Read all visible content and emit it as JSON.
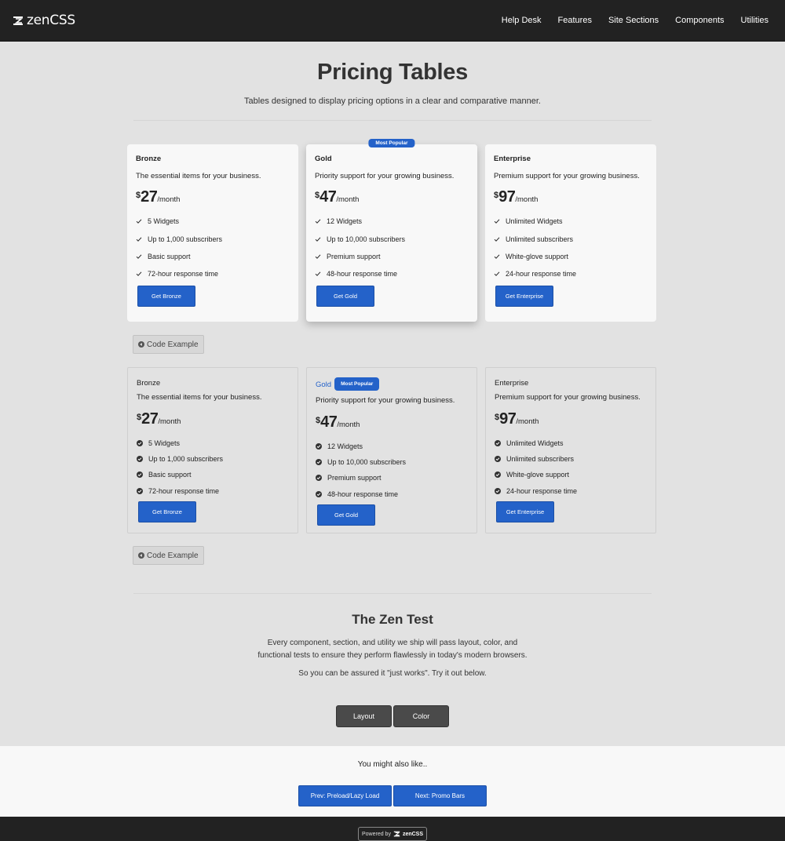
{
  "header": {
    "brand": "zenCSS",
    "nav": [
      "Help Desk",
      "Features",
      "Site Sections",
      "Components",
      "Utilities"
    ]
  },
  "hero": {
    "title": "Pricing Tables",
    "subtitle": "Tables designed to display pricing options in a clear and comparative manner."
  },
  "plans": [
    {
      "name": "Bronze",
      "desc": "The essential items for your business.",
      "currency": "$",
      "price": "27",
      "period": "/month",
      "features": [
        "5 Widgets",
        "Up to 1,000 subscribers",
        "Basic support",
        "72-hour response time"
      ],
      "cta": "Get Bronze"
    },
    {
      "name": "Gold",
      "badge": "Most Popular",
      "desc": "Priority support for your growing business.",
      "currency": "$",
      "price": "47",
      "period": "/month",
      "features": [
        "12 Widgets",
        "Up to 10,000 subscribers",
        "Premium support",
        "48-hour response time"
      ],
      "cta": "Get Gold"
    },
    {
      "name": "Enterprise",
      "desc": "Premium support for your growing business.",
      "currency": "$",
      "price": "97",
      "period": "/month",
      "features": [
        "Unlimited Widgets",
        "Unlimited subscribers",
        "White-glove support",
        "24-hour response time"
      ],
      "cta": "Get Enterprise"
    }
  ],
  "code_example": "Code Example",
  "zen": {
    "title": "The Zen Test",
    "line1": "Every component, section, and utility we ship will pass layout, color, and",
    "line2": "functional tests to ensure they perform flawlessly in today's modern browsers.",
    "line3": "So you can be assured it \"just works\". Try it out below.",
    "buttons": [
      "Layout",
      "Color"
    ]
  },
  "also": {
    "text": "You might also like..",
    "prev": "Prev: Preload/Lazy Load",
    "next": "Next: Promo Bars"
  },
  "footer": {
    "powered": "Powered by",
    "brand": "zenCSS"
  },
  "colors": {
    "accent": "#2462c9",
    "header_bg": "#222222",
    "page_bg": "#e2e2e2",
    "card_bg": "#f8f8f8"
  }
}
